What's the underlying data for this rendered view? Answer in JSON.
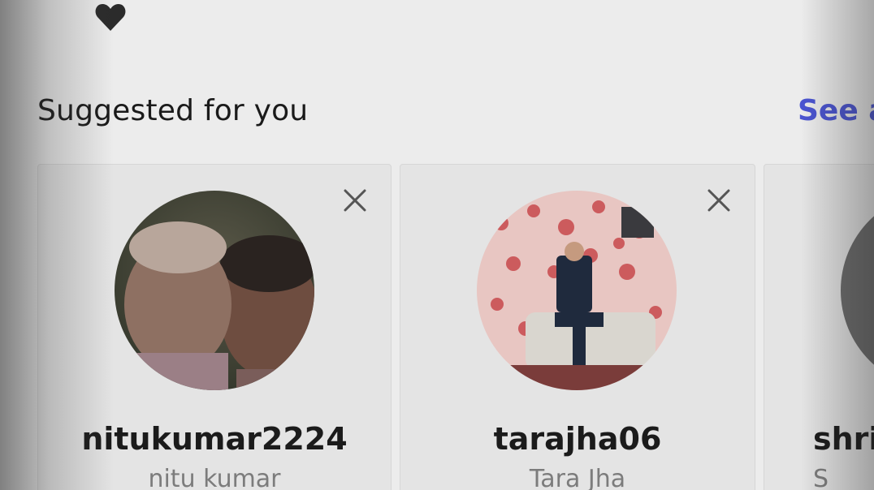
{
  "section": {
    "title": "Suggested for you",
    "see_all_label": "See a"
  },
  "icons": {
    "heart": "heart-icon",
    "close": "close-icon"
  },
  "colors": {
    "link": "#4a54d1",
    "username": "#1b1b1b",
    "fullname": "#7c7c7c",
    "background": "#ececec"
  },
  "suggestions": [
    {
      "username": "nitukumar2224",
      "full_name": "nitu kumar"
    },
    {
      "username": "tarajha06",
      "full_name": "Tara Jha"
    },
    {
      "username": "shris",
      "full_name": "S"
    }
  ]
}
